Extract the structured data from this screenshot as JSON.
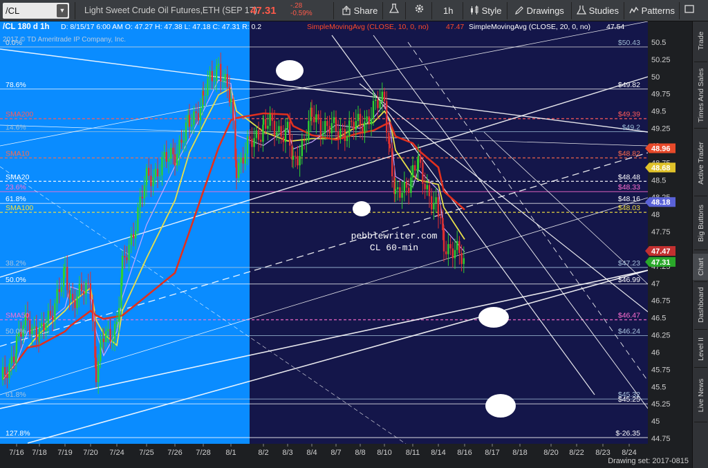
{
  "toolbar": {
    "symbol": "/CL",
    "instrument_title": "Light Sweet Crude Oil Futures,ETH (SEP 17)",
    "last_price": "47.31",
    "net_change": "-.28",
    "pct_change": "-0.59%",
    "share_label": "Share",
    "interval_label": "1h",
    "style_label": "Style",
    "drawings_label": "Drawings",
    "studies_label": "Studies",
    "patterns_label": "Patterns"
  },
  "side_tabs": [
    "Trade",
    "Times And Sales",
    "Active Trader",
    "Big Buttons",
    "Chart",
    "Dashboard",
    "Level II",
    "Live News"
  ],
  "chart_header": {
    "line1": "/CL 180 d 1h",
    "ohlc": "D: 8/15/17 6:00 AM   O: 47.27   H: 47.38   L: 47.18   C: 47.31   R: 0.2",
    "sma10_label": "SimpleMovingAvg (CLOSE, 10, 0, no)",
    "sma10_value": "47.47",
    "sma20_label": "SimpleMovingAvg (CLOSE, 20, 0, no)",
    "sma20_value": "47.54",
    "copyright": "2017 © TD Ameritrade IP Company, Inc."
  },
  "watermark": {
    "line1": "pebblewriter.com",
    "line2": "CL 60-min"
  },
  "drawing_set": "Drawing set: 2017-0815",
  "chart_data": {
    "type": "candlestick",
    "title": "Light Sweet Crude Oil Futures,ETH (SEP 17)",
    "xlabel": "",
    "ylabel": "",
    "ylim": [
      44.75,
      50.5
    ],
    "y_ticks": [
      50.5,
      50.25,
      50,
      49.75,
      49.5,
      49.25,
      49,
      48.75,
      48.5,
      48.25,
      48,
      47.75,
      47.5,
      47.25,
      47,
      46.75,
      46.5,
      46.25,
      46,
      45.75,
      45.5,
      45.25,
      45,
      44.75
    ],
    "x_ticks": [
      "7/16",
      "7/18",
      "7/19",
      "7/20",
      "7/24",
      "7/25",
      "7/26",
      "7/28",
      "8/1",
      "8/2",
      "8/3",
      "8/4",
      "8/7",
      "8/8",
      "8/10",
      "8/11",
      "8/14",
      "8/16",
      "8/17",
      "8/18",
      "8/20",
      "8/22",
      "8/23",
      "8/24"
    ],
    "price_path": [
      {
        "date": "7/14",
        "price": 45.6
      },
      {
        "date": "7/16",
        "price": 46.1
      },
      {
        "date": "7/17",
        "price": 46.5
      },
      {
        "date": "7/18",
        "price": 46.2
      },
      {
        "date": "7/19",
        "price": 47.1
      },
      {
        "date": "7/19",
        "price": 46.8
      },
      {
        "date": "7/20",
        "price": 46.9
      },
      {
        "date": "7/20",
        "price": 45.7
      },
      {
        "date": "7/21",
        "price": 46.2
      },
      {
        "date": "7/24",
        "price": 46.4
      },
      {
        "date": "7/24",
        "price": 47.2
      },
      {
        "date": "7/25",
        "price": 48.5
      },
      {
        "date": "7/26",
        "price": 48.9
      },
      {
        "date": "7/27",
        "price": 49.3
      },
      {
        "date": "7/28",
        "price": 49.7
      },
      {
        "date": "7/31",
        "price": 50.2
      },
      {
        "date": "8/1",
        "price": 49.6
      },
      {
        "date": "8/1",
        "price": 48.7
      },
      {
        "date": "8/2",
        "price": 49.3
      },
      {
        "date": "8/3",
        "price": 49.2
      },
      {
        "date": "8/3",
        "price": 48.7
      },
      {
        "date": "8/4",
        "price": 49.4
      },
      {
        "date": "8/7",
        "price": 49.2
      },
      {
        "date": "8/8",
        "price": 49.3
      },
      {
        "date": "8/9",
        "price": 49.5
      },
      {
        "date": "8/10",
        "price": 49.7
      },
      {
        "date": "8/10",
        "price": 48.9
      },
      {
        "date": "8/10",
        "price": 48.2
      },
      {
        "date": "8/11",
        "price": 48.6
      },
      {
        "date": "8/11",
        "price": 48.7
      },
      {
        "date": "8/14",
        "price": 48.0
      },
      {
        "date": "8/14",
        "price": 47.6
      },
      {
        "date": "8/15",
        "price": 47.31
      }
    ],
    "last_ohlc": {
      "date": "8/15/17 6:00 AM",
      "open": 47.27,
      "high": 47.38,
      "low": 47.18,
      "close": 47.31
    },
    "axis_badges": [
      {
        "label": "48.96",
        "value": 48.96,
        "color": "#e84a2a"
      },
      {
        "label": "48.68",
        "value": 48.68,
        "color": "#e0c22a"
      },
      {
        "label": "48.18",
        "value": 48.18,
        "color": "#5a62d8"
      },
      {
        "label": "47.47",
        "value": 47.47,
        "color": "#c23030"
      },
      {
        "label": "47.31",
        "value": 47.31,
        "color": "#2aa82a"
      }
    ],
    "level_lines": [
      {
        "left": "0.0%",
        "right": "$50.43",
        "value": 50.43,
        "left_color": "#dddddd",
        "right_color": "#9db8d0"
      },
      {
        "left": "78.6%",
        "right": "$49.82",
        "value": 49.82,
        "left_color": "#ffffff",
        "right_color": "#ffffff"
      },
      {
        "left": "SMA200",
        "right": "$49.39",
        "value": 49.39,
        "left_color": "#ff5a5a",
        "right_color": "#ff5a5a"
      },
      {
        "left": "14.6%",
        "right": "$49.2",
        "value": 49.2,
        "left_color": "#9dbfd8",
        "right_color": "#9dbfd8"
      },
      {
        "left": "SMA10",
        "right": "$48.82",
        "value": 48.82,
        "left_color": "#ff6a4a",
        "right_color": "#ff6a4a"
      },
      {
        "left": "SMA20",
        "right": "$48.48",
        "value": 48.48,
        "left_color": "#ffffff",
        "right_color": "#ffffff"
      },
      {
        "left": "23.6%",
        "right": "$48.33",
        "value": 48.33,
        "left_color": "#ff6fd0",
        "right_color": "#ff6fd0"
      },
      {
        "left": "61.8%",
        "right": "$48.16",
        "value": 48.16,
        "left_color": "#ffffff",
        "right_color": "#ffffff"
      },
      {
        "left": "SMA100",
        "right": "$48.03",
        "value": 48.03,
        "left_color": "#f2e040",
        "right_color": "#f2e040"
      },
      {
        "left": "38.2%",
        "right": "$47.23",
        "value": 47.23,
        "left_color": "#a9c4de",
        "right_color": "#a9c4de"
      },
      {
        "left": "50.0%",
        "right": "$46.99",
        "value": 46.99,
        "left_color": "#ffffff",
        "right_color": "#ffffff"
      },
      {
        "left": "SMA50",
        "right": "$46.47",
        "value": 46.47,
        "left_color": "#ff6fd0",
        "right_color": "#ff6fd0"
      },
      {
        "left": "50.0%",
        "right": "$46.24",
        "value": 46.24,
        "left_color": "#a9c4de",
        "right_color": "#a9c4de"
      },
      {
        "left": "61.8%",
        "right": "$45.32",
        "value": 45.32,
        "left_color": "#a9c4de",
        "right_color": "#a9c4de"
      },
      {
        "left": "",
        "right": "$45.25",
        "value": 45.25,
        "left_color": "#ffffff",
        "right_color": "#ffffff"
      },
      {
        "left": "127.8%",
        "right": "$-26.35",
        "value": 44.76,
        "left_color": "#ffffff",
        "right_color": "#ffffff"
      }
    ],
    "colors": {
      "highlight_region": "#0a8cff",
      "forecast_region": "#14164a",
      "sma10": "#e0301e",
      "sma20": "#e8e04a",
      "sma50": "#ff6fd0",
      "sma100": "#f2e040",
      "sma200": "#ff5a5a",
      "channel": "#ffffff",
      "candle_up": "#2fd12f",
      "candle_down": "#e03030"
    }
  }
}
